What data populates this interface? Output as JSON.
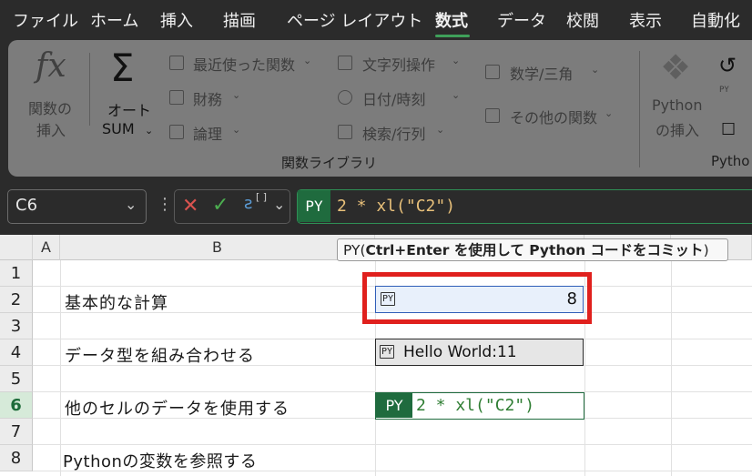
{
  "menu": {
    "file": "ファイル",
    "home": "ホーム",
    "insert": "挿入",
    "draw": "描画",
    "page_layout": "ページ レイアウト",
    "formulas": "数式",
    "data": "データ",
    "review": "校閲",
    "view": "表示",
    "automate": "自動化"
  },
  "ribbon": {
    "insert_function_line1": "関数の",
    "insert_function_line2": "挿入",
    "autosum_line1": "オート",
    "autosum_line2": "SUM",
    "recent": "最近使った関数",
    "financial": "財務",
    "logical": "論理",
    "text": "文字列操作",
    "datetime": "日付/時刻",
    "lookup": "検索/行列",
    "math": "数学/三角",
    "more": "その他の関数",
    "group_label": "関数ライブラリ",
    "python_line1": "Python",
    "python_line2": "の挿入",
    "python_group": "Pytho"
  },
  "formula_bar": {
    "name_box": "C6",
    "mode_tag": "PY",
    "formula": "2 * xl(\"C2\")"
  },
  "tooltip": {
    "prefix": "PY(",
    "bold": "Ctrl+Enter を使用して Python コードをコミット",
    "suffix": ")"
  },
  "sheet": {
    "columns": [
      "A",
      "B"
    ],
    "rows": [
      "1",
      "2",
      "3",
      "4",
      "5",
      "6",
      "7",
      "8"
    ],
    "b2": "基本的な計算",
    "b4": "データ型を組み合わせる",
    "b6": "他のセルのデータを使用する",
    "b8": "Pythonの変数を参照する",
    "c2_icon": "PY",
    "c2_value": "8",
    "c4_icon": "PY",
    "c4_value": "Hello World:11",
    "c6_tag": "PY",
    "c6_formula": "2 * xl(\"C2\")"
  },
  "colors": {
    "accent_green": "#1f6b3e",
    "highlight_red": "#e0201d",
    "selected_blue": "#2f5eb8"
  }
}
